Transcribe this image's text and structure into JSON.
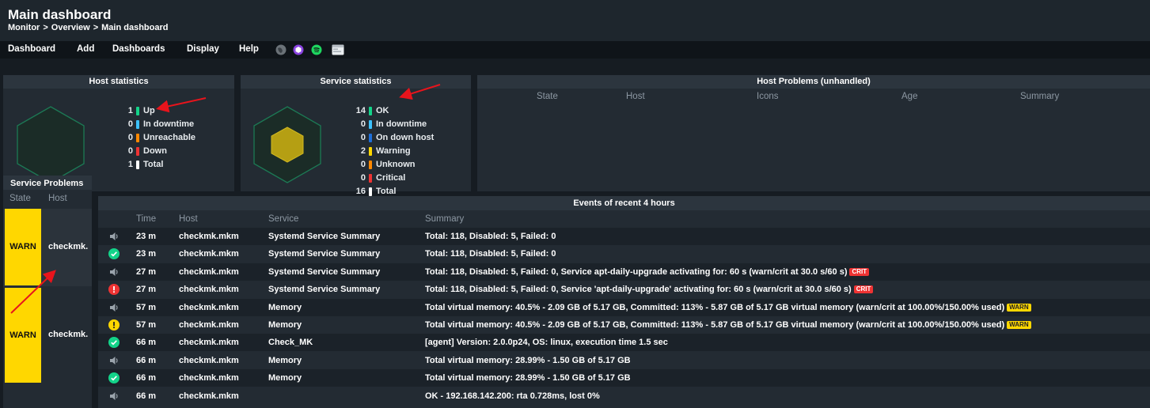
{
  "header": {
    "title": "Main dashboard",
    "breadcrumb": [
      "Monitor",
      "Overview",
      "Main dashboard"
    ],
    "separator": ">"
  },
  "menu": {
    "items": [
      "Dashboard",
      "Add",
      "Dashboards",
      "Display",
      "Help"
    ],
    "icons": [
      "globe-icon",
      "cube-icon",
      "spotify-icon",
      "window-icon"
    ]
  },
  "host_statistics": {
    "title": "Host statistics",
    "rows": [
      {
        "count": "1",
        "label": "Up",
        "color": "#13d389"
      },
      {
        "count": "0",
        "label": "In downtime",
        "color": "#3cc2ff"
      },
      {
        "count": "0",
        "label": "Unreachable",
        "color": "#ff8800"
      },
      {
        "count": "0",
        "label": "Down",
        "color": "#ee3333"
      },
      {
        "count": "1",
        "label": "Total",
        "color": "#ffffff"
      }
    ]
  },
  "service_statistics": {
    "title": "Service statistics",
    "rows": [
      {
        "count": "14",
        "label": "OK",
        "color": "#13d389"
      },
      {
        "count": "0",
        "label": "In downtime",
        "color": "#3cc2ff"
      },
      {
        "count": "0",
        "label": "On down host",
        "color": "#1e6fd9"
      },
      {
        "count": "2",
        "label": "Warning",
        "color": "#ffd700"
      },
      {
        "count": "0",
        "label": "Unknown",
        "color": "#ff8800"
      },
      {
        "count": "0",
        "label": "Critical",
        "color": "#ee3333"
      },
      {
        "count": "16",
        "label": "Total",
        "color": "#ffffff"
      }
    ]
  },
  "host_problems": {
    "title": "Host Problems (unhandled)",
    "columns": [
      "State",
      "Host",
      "Icons",
      "Age",
      "Summary"
    ]
  },
  "service_problems": {
    "title": "Service Problems",
    "columns": [
      "State",
      "Host"
    ],
    "rows": [
      {
        "state": "WARN",
        "host": "checkmk."
      },
      {
        "state": "WARN",
        "host": "checkmk."
      }
    ]
  },
  "events": {
    "title": "Events of recent 4 hours",
    "columns": [
      "Time",
      "Host",
      "Service",
      "Summary"
    ],
    "rows": [
      {
        "icon": "speaker-icon",
        "time": "23 m",
        "host": "checkmk.mkm",
        "service": "Systemd Service Summary",
        "summary": "Total: 118, Disabled: 5, Failed: 0",
        "badge": ""
      },
      {
        "icon": "ok-icon",
        "time": "23 m",
        "host": "checkmk.mkm",
        "service": "Systemd Service Summary",
        "summary": "Total: 118, Disabled: 5, Failed: 0",
        "badge": ""
      },
      {
        "icon": "speaker-icon",
        "time": "27 m",
        "host": "checkmk.mkm",
        "service": "Systemd Service Summary",
        "summary": "Total: 118, Disabled: 5, Failed: 0, Service apt-daily-upgrade activating for: 60 s (warn/crit at 30.0 s/60 s)",
        "badge": "CRIT"
      },
      {
        "icon": "crit-icon",
        "time": "27 m",
        "host": "checkmk.mkm",
        "service": "Systemd Service Summary",
        "summary": "Total: 118, Disabled: 5, Failed: 0, Service 'apt-daily-upgrade' activating for: 60 s (warn/crit at 30.0 s/60 s)",
        "badge": "CRIT"
      },
      {
        "icon": "speaker-icon",
        "time": "57 m",
        "host": "checkmk.mkm",
        "service": "Memory",
        "summary": "Total virtual memory: 40.5% - 2.09 GB of 5.17 GB, Committed: 113% - 5.87 GB of 5.17 GB virtual memory (warn/crit at 100.00%/150.00% used)",
        "badge": "WARN"
      },
      {
        "icon": "warn-icon",
        "time": "57 m",
        "host": "checkmk.mkm",
        "service": "Memory",
        "summary": "Total virtual memory: 40.5% - 2.09 GB of 5.17 GB, Committed: 113% - 5.87 GB of 5.17 GB virtual memory (warn/crit at 100.00%/150.00% used)",
        "badge": "WARN"
      },
      {
        "icon": "ok-icon",
        "time": "66 m",
        "host": "checkmk.mkm",
        "service": "Check_MK",
        "summary": "[agent] Version: 2.0.0p24, OS: linux, execution time 1.5 sec",
        "badge": ""
      },
      {
        "icon": "speaker-icon",
        "time": "66 m",
        "host": "checkmk.mkm",
        "service": "Memory",
        "summary": "Total virtual memory: 28.99% - 1.50 GB of 5.17 GB",
        "badge": ""
      },
      {
        "icon": "ok-icon",
        "time": "66 m",
        "host": "checkmk.mkm",
        "service": "Memory",
        "summary": "Total virtual memory: 28.99% - 1.50 GB of 5.17 GB",
        "badge": ""
      },
      {
        "icon": "speaker-icon",
        "time": "66 m",
        "host": "checkmk.mkm",
        "service": "",
        "summary": "OK - 192.168.142.200: rta 0.728ms, lost 0%",
        "badge": ""
      }
    ]
  },
  "colors": {
    "ok": "#13d389",
    "warn": "#ffd700",
    "crit": "#ee3333",
    "annotation": "#e8141c"
  }
}
